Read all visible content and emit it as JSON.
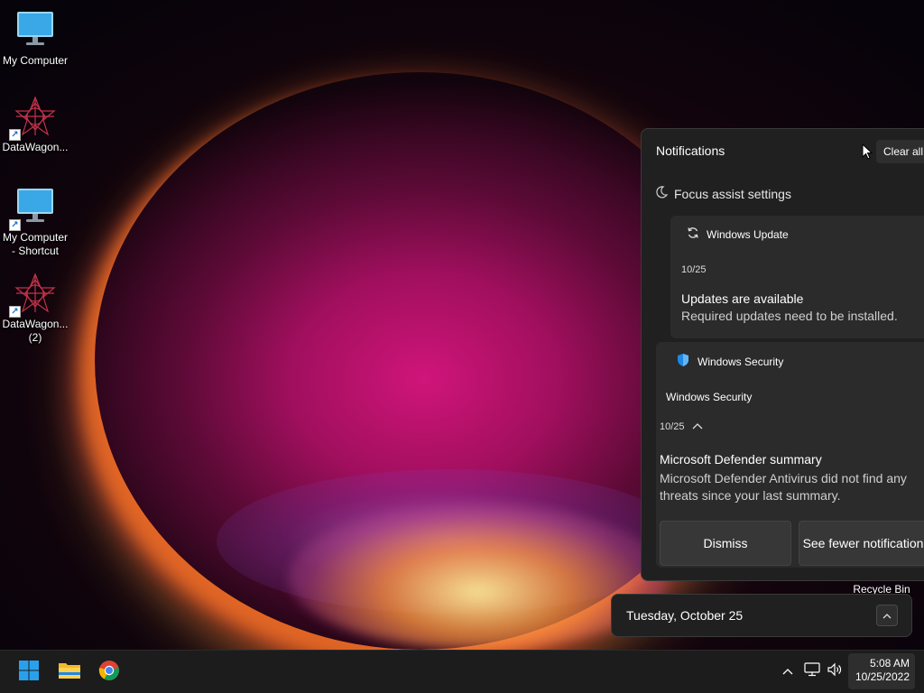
{
  "desktop": {
    "icons": [
      {
        "label": "My Computer"
      },
      {
        "label": "DataWagon..."
      },
      {
        "label": "My Computer - Shortcut"
      },
      {
        "label": "DataWagon... (2)"
      }
    ],
    "recycle_bin_label": "Recycle Bin"
  },
  "notifications": {
    "title": "Notifications",
    "clear_all_label": "Clear all",
    "focus_assist_label": "Focus assist settings",
    "windows_update": {
      "app_name": "Windows Update",
      "date": "10/25",
      "heading": "Updates are available",
      "body": "Required updates need to be installed."
    },
    "windows_security": {
      "app_name": "Windows Security",
      "subtitle": "Windows Security",
      "date": "10/25",
      "heading": "Microsoft Defender summary",
      "body": "Microsoft Defender Antivirus did not find any threats since your last summary.",
      "dismiss_label": "Dismiss",
      "see_fewer_label": "See fewer notifications"
    }
  },
  "calendar_flyout": {
    "date_text": "Tuesday, October 25"
  },
  "taskbar": {
    "pinned": [
      "start-icon",
      "file-explorer-icon",
      "chrome-icon"
    ],
    "tray_icons": [
      "chevron-up-icon",
      "network-icon",
      "volume-icon"
    ],
    "clock_time": "5:08 AM",
    "clock_date": "10/25/2022"
  },
  "colors": {
    "panel_bg": "#202020",
    "card_bg": "#2b2b2b",
    "taskbar_bg": "#1c1c1c",
    "accent": "#0078d4"
  }
}
